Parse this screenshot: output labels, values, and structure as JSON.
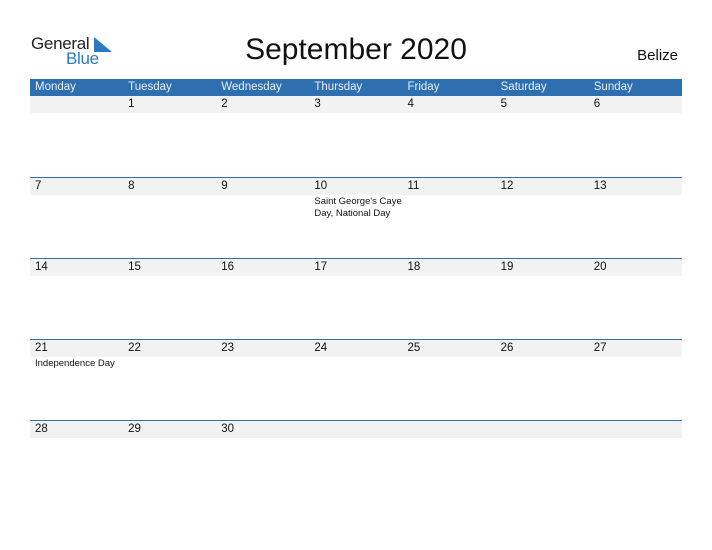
{
  "logo": {
    "general": "General",
    "blue": "Blue",
    "icon": "logo-triangle-icon"
  },
  "title": "September 2020",
  "country": "Belize",
  "colors": {
    "accent": "#2e6fb0",
    "brand_blue": "#2b79c2",
    "day_band": "#f2f2f2"
  },
  "weekdays": [
    "Monday",
    "Tuesday",
    "Wednesday",
    "Thursday",
    "Friday",
    "Saturday",
    "Sunday"
  ],
  "weeks": [
    {
      "days": [
        {
          "num": "",
          "holiday": ""
        },
        {
          "num": "1",
          "holiday": ""
        },
        {
          "num": "2",
          "holiday": ""
        },
        {
          "num": "3",
          "holiday": ""
        },
        {
          "num": "4",
          "holiday": ""
        },
        {
          "num": "5",
          "holiday": ""
        },
        {
          "num": "6",
          "holiday": ""
        }
      ]
    },
    {
      "days": [
        {
          "num": "7",
          "holiday": ""
        },
        {
          "num": "8",
          "holiday": ""
        },
        {
          "num": "9",
          "holiday": ""
        },
        {
          "num": "10",
          "holiday": "Saint George's Caye Day, National Day"
        },
        {
          "num": "11",
          "holiday": ""
        },
        {
          "num": "12",
          "holiday": ""
        },
        {
          "num": "13",
          "holiday": ""
        }
      ]
    },
    {
      "days": [
        {
          "num": "14",
          "holiday": ""
        },
        {
          "num": "15",
          "holiday": ""
        },
        {
          "num": "16",
          "holiday": ""
        },
        {
          "num": "17",
          "holiday": ""
        },
        {
          "num": "18",
          "holiday": ""
        },
        {
          "num": "19",
          "holiday": ""
        },
        {
          "num": "20",
          "holiday": ""
        }
      ]
    },
    {
      "days": [
        {
          "num": "21",
          "holiday": "Independence Day"
        },
        {
          "num": "22",
          "holiday": ""
        },
        {
          "num": "23",
          "holiday": ""
        },
        {
          "num": "24",
          "holiday": ""
        },
        {
          "num": "25",
          "holiday": ""
        },
        {
          "num": "26",
          "holiday": ""
        },
        {
          "num": "27",
          "holiday": ""
        }
      ]
    },
    {
      "days": [
        {
          "num": "28",
          "holiday": ""
        },
        {
          "num": "29",
          "holiday": ""
        },
        {
          "num": "30",
          "holiday": ""
        },
        {
          "num": "",
          "holiday": ""
        },
        {
          "num": "",
          "holiday": ""
        },
        {
          "num": "",
          "holiday": ""
        },
        {
          "num": "",
          "holiday": ""
        }
      ]
    }
  ]
}
